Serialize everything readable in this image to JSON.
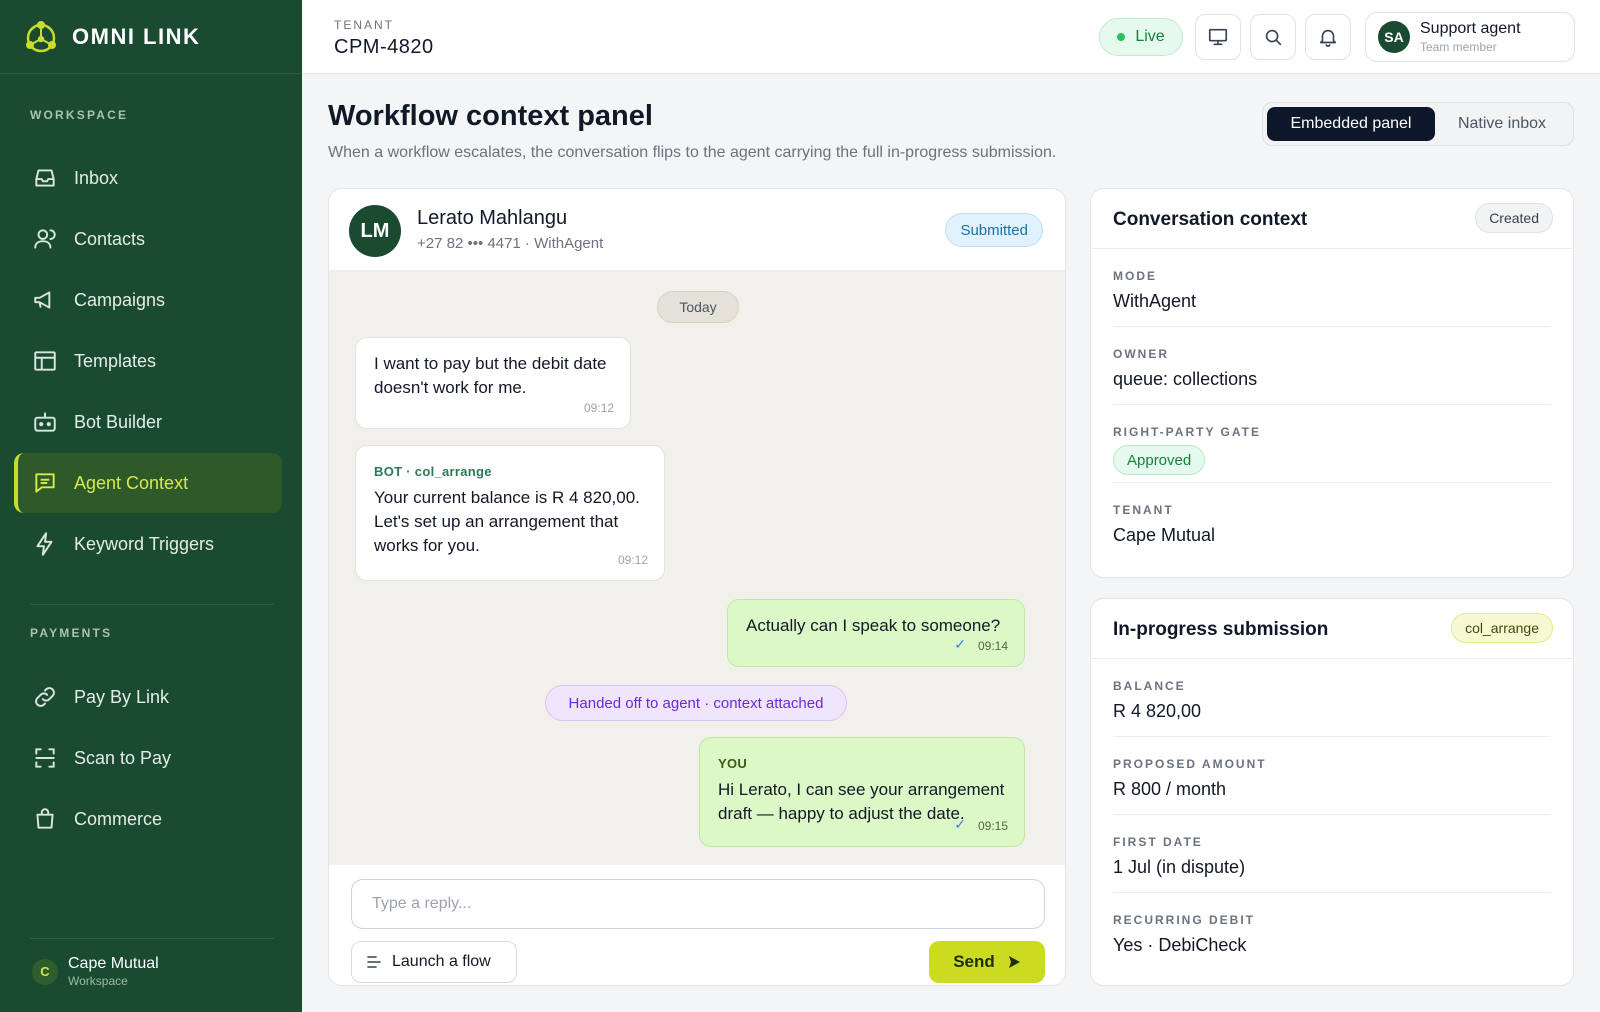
{
  "brand": {
    "name": "OMNI LINK"
  },
  "sidebar": {
    "workspace_label": "WORKSPACE",
    "payments_label": "PAYMENTS",
    "items": [
      {
        "label": "Inbox",
        "icon": "inbox-icon"
      },
      {
        "label": "Contacts",
        "icon": "contacts-icon"
      },
      {
        "label": "Campaigns",
        "icon": "megaphone-icon"
      },
      {
        "label": "Templates",
        "icon": "template-icon"
      },
      {
        "label": "Bot Builder",
        "icon": "bot-icon"
      },
      {
        "label": "Agent Context",
        "icon": "chat-icon",
        "active": true
      },
      {
        "label": "Keyword Triggers",
        "icon": "bolt-icon"
      }
    ],
    "payment_items": [
      {
        "label": "Pay By Link",
        "icon": "link-icon"
      },
      {
        "label": "Scan to Pay",
        "icon": "scan-icon"
      },
      {
        "label": "Commerce",
        "icon": "bag-icon"
      }
    ],
    "workspace": {
      "initial": "C",
      "name": "Cape Mutual",
      "sub": "Workspace"
    }
  },
  "topbar": {
    "tenant_label": "TENANT",
    "tenant_value": "CPM-4820",
    "live_label": "Live",
    "user": {
      "initials": "SA",
      "name": "Support agent",
      "role": "Team member"
    }
  },
  "page": {
    "title": "Workflow context panel",
    "subtitle": "When a workflow escalates, the conversation flips to the agent carrying the full in-progress submission.",
    "toggle": {
      "active": "Embedded panel",
      "inactive": "Native inbox"
    }
  },
  "chat": {
    "contact": {
      "initials": "LM",
      "name": "Lerato Mahlangu",
      "meta": "+27 82 ••• 4471 · WithAgent"
    },
    "status": "Submitted",
    "date_label": "Today",
    "messages": [
      {
        "text": "I want to pay but the debit date doesn't work for me.",
        "time": "09:12"
      },
      {
        "sender": "BOT · col_arrange",
        "text": "Your current balance is R 4 820,00. Let's set up an arrangement that works for you.",
        "time": "09:12"
      },
      {
        "text": "Actually can I speak to someone?",
        "time": "09:14"
      },
      {
        "sender": "YOU",
        "text": "Hi Lerato, I can see your arrangement draft — happy to adjust the date.",
        "time": "09:15"
      }
    ],
    "handoff_label": "Handed off to agent · context attached",
    "reply_placeholder": "Type a reply...",
    "launch_flow_label": "Launch a flow",
    "send_label": "Send"
  },
  "context": {
    "title": "Conversation context",
    "badge": "Created",
    "fields": {
      "mode_label": "MODE",
      "mode_value": "WithAgent",
      "owner_label": "OWNER",
      "owner_value": "queue: collections",
      "gate_label": "RIGHT-PARTY GATE",
      "gate_value": "Approved",
      "tenant_label": "TENANT",
      "tenant_value": "Cape Mutual"
    }
  },
  "submission": {
    "title": "In-progress submission",
    "badge": "col_arrange",
    "fields": {
      "balance_label": "BALANCE",
      "balance_value": "R 4 820,00",
      "amount_label": "PROPOSED AMOUNT",
      "amount_value": "R 800 / month",
      "date_label": "FIRST DATE",
      "date_value": "1 Jul (in dispute)",
      "debit_label": "RECURRING DEBIT",
      "debit_value": "Yes · DebiCheck"
    }
  },
  "colors": {
    "sidebar_bg": "#1a4a30",
    "accent": "#cbdb1f",
    "outgoing_bubble": "#dcf8c6",
    "chat_bg": "#f1f0ea"
  }
}
